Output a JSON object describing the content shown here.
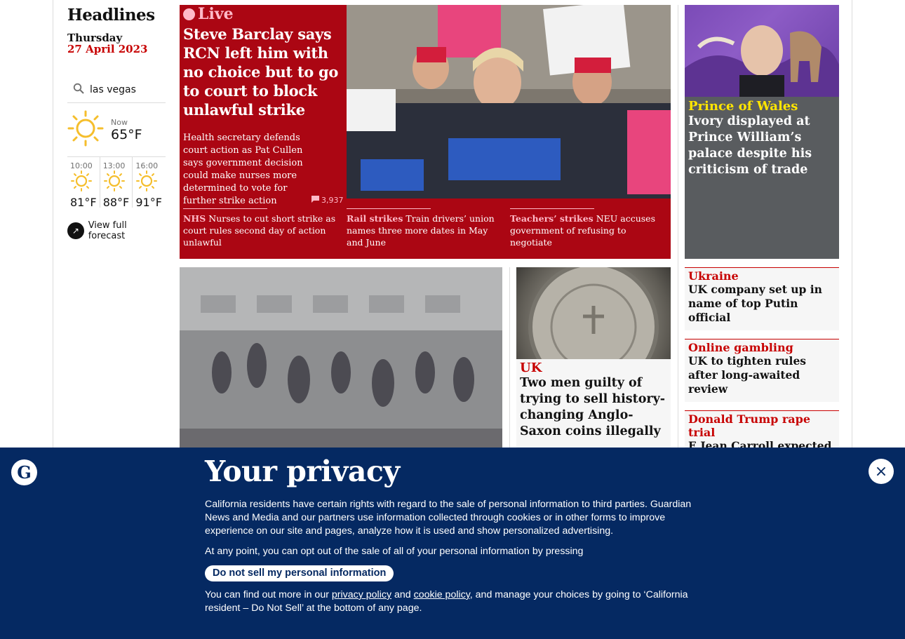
{
  "headlines": {
    "title": "Headlines",
    "day": "Thursday",
    "date": "27 April 2023"
  },
  "weather": {
    "location": "las vegas",
    "now_label": "Now",
    "now_temp": "65°F",
    "forecast": [
      {
        "time": "10:00",
        "temp": "81°F"
      },
      {
        "time": "13:00",
        "temp": "88°F"
      },
      {
        "time": "16:00",
        "temp": "91°F"
      }
    ],
    "full_forecast_label": "View full forecast"
  },
  "top_story": {
    "live_label": "Live",
    "headline": "Steve Barclay says RCN left him with no choice but to go to court to block unlawful strike",
    "standfirst": "Health secretary defends court action as Pat Cullen says government decision could make nurses more determined to vote for further strike action",
    "comments": "3,937",
    "sublinks": [
      {
        "kicker": "NHS",
        "text": "Nurses to cut short strike as court rules second day of action unlawful"
      },
      {
        "kicker": "Rail strikes",
        "text": "Train drivers’ union names three more dates in May and June"
      },
      {
        "kicker": "Teachers’ strikes",
        "text": "NEU accuses government of refusing to negotiate"
      }
    ]
  },
  "prince": {
    "kicker": "Prince of Wales",
    "headline": "Ivory displayed at Prince William’s palace despite his criticism of trade"
  },
  "side_stories": [
    {
      "kicker": "Ukraine",
      "headline": "UK company set up in name of top Putin official"
    },
    {
      "kicker": "Online gambling",
      "headline": "UK to tighten rules after long-awaited review"
    },
    {
      "kicker": "Donald Trump rape trial",
      "headline": "E Jean Carroll expected to face tough cross-examination"
    }
  ],
  "coin_story": {
    "kicker": "UK",
    "headline": "Two men guilty of trying to sell history-changing Anglo-Saxon coins illegally"
  },
  "privacy": {
    "logo": "G",
    "title": "Your privacy",
    "para1": "California residents have certain rights with regard to the sale of personal information to third parties. Guardian News and Media and our partners use information collected through cookies or in other forms to improve experience on our site and pages, analyze how it is used and show personalized advertising.",
    "para2": "At any point, you can opt out of the sale of all of your personal information by pressing",
    "button": "Do not sell my personal information",
    "para3_a": "You can find out more in our ",
    "privacy_link": "privacy policy",
    "para3_b": " and ",
    "cookie_link": "cookie policy",
    "para3_c": ", and manage your choices by going to ‘California resident – Do Not Sell’ at the bottom of any page.",
    "close": "×"
  },
  "colors": {
    "news_red": "#c70000",
    "live_bg": "#ab0613",
    "privacy_bg": "#052962",
    "prince_yellow": "#ffe500"
  }
}
